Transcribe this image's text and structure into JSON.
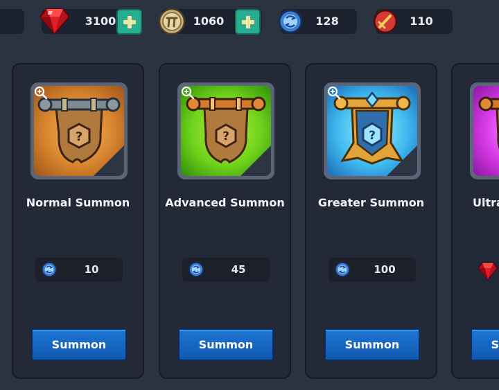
{
  "currencies": {
    "gems": {
      "value": "3100",
      "icon": "ruby-gem-icon"
    },
    "coins": {
      "value": "1060",
      "icon": "gold-coin-icon"
    },
    "blue_tokens": {
      "value": "128",
      "icon": "blue-summon-token-icon"
    },
    "red_tokens": {
      "value": "110",
      "icon": "red-sword-token-icon"
    }
  },
  "cards": [
    {
      "title": "Normal Summon",
      "cost": "10",
      "cost_icon": "blue-summon-token-icon",
      "button": "Summon",
      "theme": "#d8842e"
    },
    {
      "title": "Advanced Summon",
      "cost": "45",
      "cost_icon": "blue-summon-token-icon",
      "button": "Summon",
      "theme": "#6fd21b"
    },
    {
      "title": "Greater Summon",
      "cost": "100",
      "cost_icon": "blue-summon-token-icon",
      "button": "Summon",
      "theme": "#3fb9ef"
    },
    {
      "title": "Ultra Summon",
      "cost": "",
      "cost_icon": "ruby-gem-icon",
      "button": "Summon",
      "theme": "#d639e6"
    }
  ]
}
